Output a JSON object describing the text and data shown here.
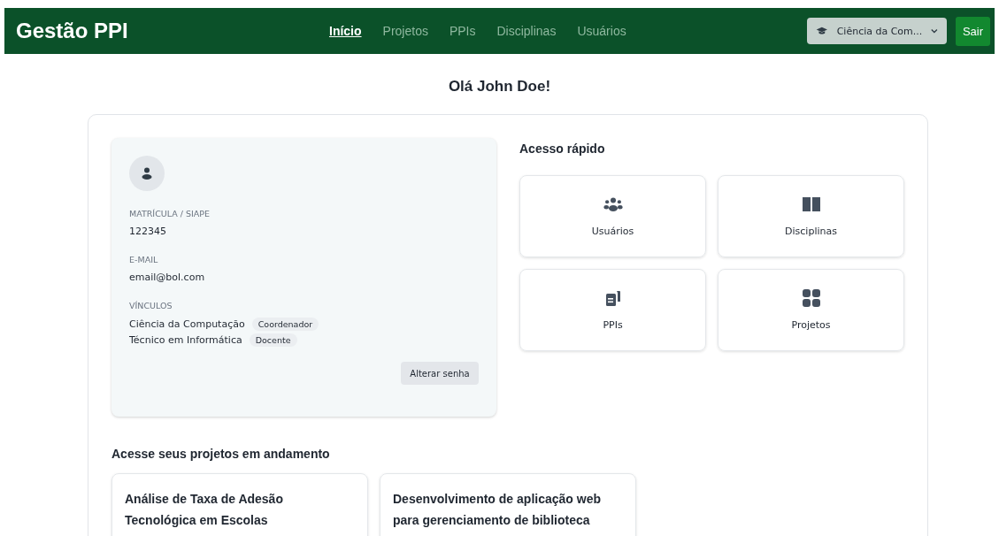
{
  "header": {
    "brand": "Gestão PPI",
    "nav": [
      {
        "label": "Início",
        "selected": true
      },
      {
        "label": "Projetos",
        "selected": false
      },
      {
        "label": "PPIs",
        "selected": false
      },
      {
        "label": "Disciplinas",
        "selected": false
      },
      {
        "label": "Usuários",
        "selected": false
      }
    ],
    "course_select": {
      "value": "Ciência da Com..."
    },
    "logout": "Sair"
  },
  "greeting": "Olá John Doe!",
  "profile": {
    "fields": [
      {
        "label": "MATRÍCULA / SIAPE",
        "value": "122345"
      },
      {
        "label": "E-MAIL",
        "value": "email@bol.com"
      }
    ],
    "links_label": "VÍNCULOS",
    "links": [
      {
        "course": "Ciência da Computação",
        "role": "Coordenador"
      },
      {
        "course": "Técnico em Informática",
        "role": "Docente"
      }
    ],
    "change_password": "Alterar senha"
  },
  "quick_access": {
    "title": "Acesso rápido",
    "items": [
      {
        "kind": "users",
        "label": "Usuários"
      },
      {
        "kind": "book",
        "label": "Disciplinas"
      },
      {
        "kind": "docs",
        "label": "PPIs"
      },
      {
        "kind": "grid",
        "label": "Projetos"
      }
    ]
  },
  "projects": {
    "title": "Acesse seus projetos em andamento",
    "items": [
      {
        "title": "Análise de Taxa de Adesão Tecnológica em Escolas"
      },
      {
        "title": "Desenvolvimento de aplicação web para gerenciamento de biblioteca"
      }
    ]
  }
}
